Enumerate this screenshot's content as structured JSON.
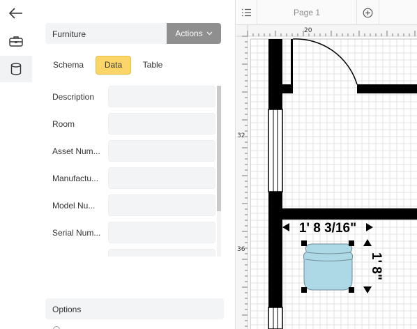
{
  "entity": {
    "name": "Furniture",
    "actions_label": "Actions"
  },
  "tabs": [
    {
      "label": "Schema",
      "active": false
    },
    {
      "label": "Data",
      "active": true
    },
    {
      "label": "Table",
      "active": false
    }
  ],
  "fields": [
    {
      "label": "Description",
      "value": ""
    },
    {
      "label": "Room",
      "value": ""
    },
    {
      "label": "Asset Num...",
      "value": ""
    },
    {
      "label": "Manufactu...",
      "value": ""
    },
    {
      "label": "Model Nu...",
      "value": ""
    },
    {
      "label": "Serial Num...",
      "value": ""
    },
    {
      "label": "",
      "value": ""
    }
  ],
  "options_label": "Options",
  "canvas": {
    "page_label": "Page 1",
    "ruler_top_label": "20",
    "ruler_left_labels": [
      "32",
      "36"
    ],
    "dimension_width": "1' 8 3/16\"",
    "dimension_height": "1' 8\""
  },
  "icons": {
    "back": "arrow-left-icon",
    "briefcase": "briefcase-icon",
    "database": "database-icon",
    "pages": "list-icon",
    "add_page": "plus-circle-icon",
    "actions_chevron": "chevron-down-icon"
  },
  "colors": {
    "active_tab": "#fcd569",
    "actions_button": "#8f8f8f",
    "chair_fill": "#add8e6",
    "wall": "#000000"
  }
}
